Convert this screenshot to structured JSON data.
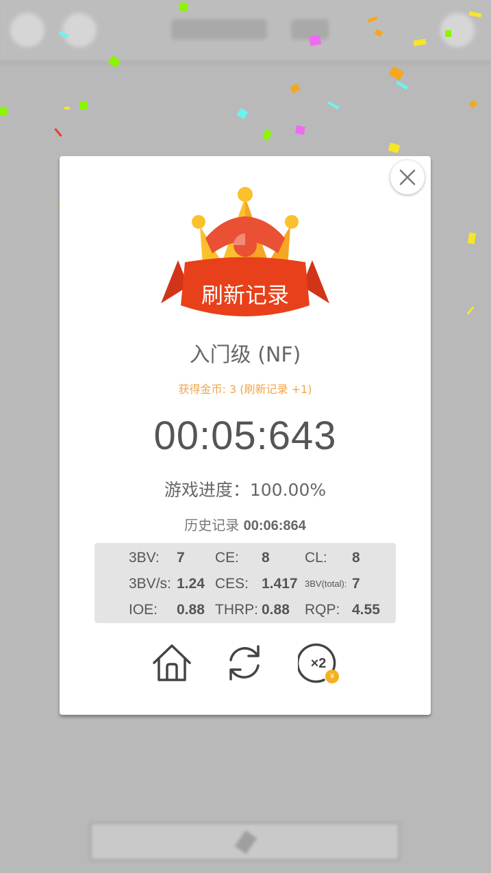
{
  "dialog": {
    "badge_label": "刷新记录",
    "level": "入门级 (NF)",
    "coins_text": "获得金币: 3 (刷新记录 +1)",
    "time": "00:05:643",
    "progress": "游戏进度：100.00%",
    "history_label": "历史记录",
    "history_value": "00:06:864"
  },
  "stats": {
    "bv_label": "3BV:",
    "bv_value": "7",
    "ce_label": "CE:",
    "ce_value": "8",
    "cl_label": "CL:",
    "cl_value": "8",
    "bvs_label": "3BV/s:",
    "bvs_value": "1.24",
    "ces_label": "CES:",
    "ces_value": "1.417",
    "bvtotal_label": "3BV(total):",
    "bvtotal_value": "7",
    "ioe_label": "IOE:",
    "ioe_value": "0.88",
    "thrp_label": "THRP:",
    "thrp_value": "0.88",
    "rqp_label": "RQP:",
    "rqp_value": "4.55"
  },
  "actions": {
    "home_icon": "home-icon",
    "restart_icon": "refresh-icon",
    "double_icon": "x2-icon",
    "double_text": "×2",
    "coin_symbol": "¥"
  },
  "colors": {
    "ribbon": "#e8401a",
    "crown_gold": "#fbc02d",
    "crown_red": "#ea5034",
    "coins_text": "#f3a447"
  }
}
